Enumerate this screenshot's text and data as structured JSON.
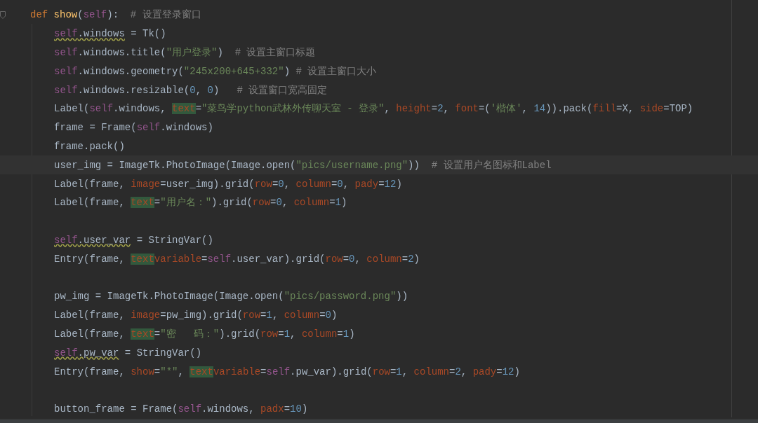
{
  "editor": {
    "function": {
      "current": false,
      "fold": true,
      "tokens": [
        {
          "kind": "keyword",
          "text": "def "
        },
        {
          "kind": "func",
          "text": "show"
        },
        {
          "kind": "plain",
          "text": "("
        },
        {
          "kind": "self",
          "text": "self"
        },
        {
          "kind": "plain",
          "text": "):  "
        },
        {
          "kind": "comment",
          "text": "# 设置登录窗口"
        }
      ],
      "children": [
        {
          "kind": "code",
          "current": false,
          "tokens": [
            {
              "kind": "self_warn",
              "text": "self"
            },
            {
              "kind": "plain_warn",
              "text": ".windows"
            },
            {
              "kind": "plain",
              "text": " = Tk()"
            }
          ]
        },
        {
          "kind": "code",
          "current": false,
          "tokens": [
            {
              "kind": "self",
              "text": "self"
            },
            {
              "kind": "plain",
              "text": ".windows.title("
            },
            {
              "kind": "string",
              "text": "\"用户登录\""
            },
            {
              "kind": "plain",
              "text": ")  "
            },
            {
              "kind": "comment",
              "text": "# 设置主窗口标题"
            }
          ]
        },
        {
          "kind": "code",
          "current": false,
          "tokens": [
            {
              "kind": "self",
              "text": "self"
            },
            {
              "kind": "plain",
              "text": ".windows.geometry("
            },
            {
              "kind": "string",
              "text": "\"245x200+645+332\""
            },
            {
              "kind": "plain",
              "text": ")"
            },
            {
              "kind": "comment",
              "text": " # 设置主窗口大小"
            }
          ]
        },
        {
          "kind": "code",
          "current": false,
          "tokens": [
            {
              "kind": "self",
              "text": "self"
            },
            {
              "kind": "plain",
              "text": ".windows.resizable("
            },
            {
              "kind": "number",
              "text": "0"
            },
            {
              "kind": "plain",
              "text": ", "
            },
            {
              "kind": "number",
              "text": "0"
            },
            {
              "kind": "plain",
              "text": ")   "
            },
            {
              "kind": "comment",
              "text": "# 设置窗口宽高固定"
            }
          ]
        },
        {
          "kind": "code",
          "current": false,
          "tokens": [
            {
              "kind": "plain",
              "text": "Label("
            },
            {
              "kind": "self",
              "text": "self"
            },
            {
              "kind": "plain",
              "text": ".windows, "
            },
            {
              "kind": "param_match",
              "text": "text"
            },
            {
              "kind": "plain",
              "text": "="
            },
            {
              "kind": "string",
              "text": "\"菜鸟学python武林外传聊天室 - 登录\""
            },
            {
              "kind": "plain",
              "text": ", "
            },
            {
              "kind": "param",
              "text": "height"
            },
            {
              "kind": "plain",
              "text": "="
            },
            {
              "kind": "number",
              "text": "2"
            },
            {
              "kind": "plain",
              "text": ", "
            },
            {
              "kind": "param",
              "text": "font"
            },
            {
              "kind": "plain",
              "text": "=("
            },
            {
              "kind": "string",
              "text": "'楷体'"
            },
            {
              "kind": "plain",
              "text": ", "
            },
            {
              "kind": "number",
              "text": "14"
            },
            {
              "kind": "plain",
              "text": ")).pack("
            },
            {
              "kind": "param",
              "text": "fill"
            },
            {
              "kind": "plain",
              "text": "=X, "
            },
            {
              "kind": "param",
              "text": "side"
            },
            {
              "kind": "plain",
              "text": "=TOP)"
            }
          ]
        },
        {
          "kind": "code",
          "current": false,
          "tokens": [
            {
              "kind": "plain",
              "text": "frame = Frame("
            },
            {
              "kind": "self",
              "text": "self"
            },
            {
              "kind": "plain",
              "text": ".windows)"
            }
          ]
        },
        {
          "kind": "code",
          "current": false,
          "tokens": [
            {
              "kind": "plain",
              "text": "frame.pack()"
            }
          ]
        },
        {
          "kind": "code",
          "current": true,
          "tokens": [
            {
              "kind": "plain",
              "text": "user_img = ImageTk.PhotoImage(Image.open("
            },
            {
              "kind": "string",
              "text": "\"pics/username.png\""
            },
            {
              "kind": "plain",
              "text": "))  "
            },
            {
              "kind": "comment",
              "text": "# 设置用户名图标和Label"
            }
          ]
        },
        {
          "kind": "code",
          "current": false,
          "tokens": [
            {
              "kind": "plain",
              "text": "Label(frame, "
            },
            {
              "kind": "param",
              "text": "image"
            },
            {
              "kind": "plain",
              "text": "=user_img).grid("
            },
            {
              "kind": "param",
              "text": "row"
            },
            {
              "kind": "plain",
              "text": "="
            },
            {
              "kind": "number",
              "text": "0"
            },
            {
              "kind": "plain",
              "text": ", "
            },
            {
              "kind": "param",
              "text": "column"
            },
            {
              "kind": "plain",
              "text": "="
            },
            {
              "kind": "number",
              "text": "0"
            },
            {
              "kind": "plain",
              "text": ", "
            },
            {
              "kind": "param",
              "text": "pady"
            },
            {
              "kind": "plain",
              "text": "="
            },
            {
              "kind": "number",
              "text": "12"
            },
            {
              "kind": "plain",
              "text": ")"
            }
          ]
        },
        {
          "kind": "code",
          "current": false,
          "tokens": [
            {
              "kind": "plain",
              "text": "Label(frame, "
            },
            {
              "kind": "param_match",
              "text": "text"
            },
            {
              "kind": "plain",
              "text": "="
            },
            {
              "kind": "string",
              "text": "\"用户名：\""
            },
            {
              "kind": "plain",
              "text": ").grid("
            },
            {
              "kind": "param",
              "text": "row"
            },
            {
              "kind": "plain",
              "text": "="
            },
            {
              "kind": "number",
              "text": "0"
            },
            {
              "kind": "plain",
              "text": ", "
            },
            {
              "kind": "param",
              "text": "column"
            },
            {
              "kind": "plain",
              "text": "="
            },
            {
              "kind": "number",
              "text": "1"
            },
            {
              "kind": "plain",
              "text": ")"
            }
          ]
        },
        {
          "kind": "blank",
          "current": false
        },
        {
          "kind": "code",
          "current": false,
          "tokens": [
            {
              "kind": "self_warn",
              "text": "self"
            },
            {
              "kind": "plain_warn",
              "text": ".user_var"
            },
            {
              "kind": "plain",
              "text": " = StringVar()"
            }
          ]
        },
        {
          "kind": "code",
          "current": false,
          "tokens": [
            {
              "kind": "plain",
              "text": "Entry(frame, "
            },
            {
              "kind": "param_match",
              "text": "text"
            },
            {
              "kind": "param",
              "text": "variable"
            },
            {
              "kind": "plain",
              "text": "="
            },
            {
              "kind": "self",
              "text": "self"
            },
            {
              "kind": "plain",
              "text": ".user_var).grid("
            },
            {
              "kind": "param",
              "text": "row"
            },
            {
              "kind": "plain",
              "text": "="
            },
            {
              "kind": "number",
              "text": "0"
            },
            {
              "kind": "plain",
              "text": ", "
            },
            {
              "kind": "param",
              "text": "column"
            },
            {
              "kind": "plain",
              "text": "="
            },
            {
              "kind": "number",
              "text": "2"
            },
            {
              "kind": "plain",
              "text": ")"
            }
          ]
        },
        {
          "kind": "blank",
          "current": false
        },
        {
          "kind": "code",
          "current": false,
          "tokens": [
            {
              "kind": "plain",
              "text": "pw_img = ImageTk.PhotoImage(Image.open("
            },
            {
              "kind": "string",
              "text": "\"pics/password.png\""
            },
            {
              "kind": "plain",
              "text": "))"
            }
          ]
        },
        {
          "kind": "code",
          "current": false,
          "tokens": [
            {
              "kind": "plain",
              "text": "Label(frame, "
            },
            {
              "kind": "param",
              "text": "image"
            },
            {
              "kind": "plain",
              "text": "=pw_img).grid("
            },
            {
              "kind": "param",
              "text": "row"
            },
            {
              "kind": "plain",
              "text": "="
            },
            {
              "kind": "number",
              "text": "1"
            },
            {
              "kind": "plain",
              "text": ", "
            },
            {
              "kind": "param",
              "text": "column"
            },
            {
              "kind": "plain",
              "text": "="
            },
            {
              "kind": "number",
              "text": "0"
            },
            {
              "kind": "plain",
              "text": ")"
            }
          ]
        },
        {
          "kind": "code",
          "current": false,
          "tokens": [
            {
              "kind": "plain",
              "text": "Label(frame, "
            },
            {
              "kind": "param_match",
              "text": "text"
            },
            {
              "kind": "plain",
              "text": "="
            },
            {
              "kind": "string",
              "text": "\"密   码：\""
            },
            {
              "kind": "plain",
              "text": ").grid("
            },
            {
              "kind": "param",
              "text": "row"
            },
            {
              "kind": "plain",
              "text": "="
            },
            {
              "kind": "number",
              "text": "1"
            },
            {
              "kind": "plain",
              "text": ", "
            },
            {
              "kind": "param",
              "text": "column"
            },
            {
              "kind": "plain",
              "text": "="
            },
            {
              "kind": "number",
              "text": "1"
            },
            {
              "kind": "plain",
              "text": ")"
            }
          ]
        },
        {
          "kind": "code",
          "current": false,
          "tokens": [
            {
              "kind": "self_warn",
              "text": "self"
            },
            {
              "kind": "plain_warn",
              "text": ".pw_var"
            },
            {
              "kind": "plain",
              "text": " = StringVar()"
            }
          ]
        },
        {
          "kind": "code",
          "current": false,
          "tokens": [
            {
              "kind": "plain",
              "text": "Entry(frame, "
            },
            {
              "kind": "param",
              "text": "show"
            },
            {
              "kind": "plain",
              "text": "="
            },
            {
              "kind": "string",
              "text": "\"*\""
            },
            {
              "kind": "plain",
              "text": ", "
            },
            {
              "kind": "param_match",
              "text": "text"
            },
            {
              "kind": "param",
              "text": "variable"
            },
            {
              "kind": "plain",
              "text": "="
            },
            {
              "kind": "self",
              "text": "self"
            },
            {
              "kind": "plain",
              "text": ".pw_var).grid("
            },
            {
              "kind": "param",
              "text": "row"
            },
            {
              "kind": "plain",
              "text": "="
            },
            {
              "kind": "number",
              "text": "1"
            },
            {
              "kind": "plain",
              "text": ", "
            },
            {
              "kind": "param",
              "text": "column"
            },
            {
              "kind": "plain",
              "text": "="
            },
            {
              "kind": "number",
              "text": "2"
            },
            {
              "kind": "plain",
              "text": ", "
            },
            {
              "kind": "param",
              "text": "pady"
            },
            {
              "kind": "plain",
              "text": "="
            },
            {
              "kind": "number",
              "text": "12"
            },
            {
              "kind": "plain",
              "text": ")"
            }
          ]
        },
        {
          "kind": "blank",
          "current": false
        },
        {
          "kind": "code",
          "current": false,
          "tokens": [
            {
              "kind": "plain",
              "text": "button_frame = Frame("
            },
            {
              "kind": "self",
              "text": "self"
            },
            {
              "kind": "plain",
              "text": ".windows, "
            },
            {
              "kind": "param",
              "text": "padx"
            },
            {
              "kind": "plain",
              "text": "="
            },
            {
              "kind": "number",
              "text": "10"
            },
            {
              "kind": "plain",
              "text": ")"
            }
          ]
        }
      ]
    }
  }
}
